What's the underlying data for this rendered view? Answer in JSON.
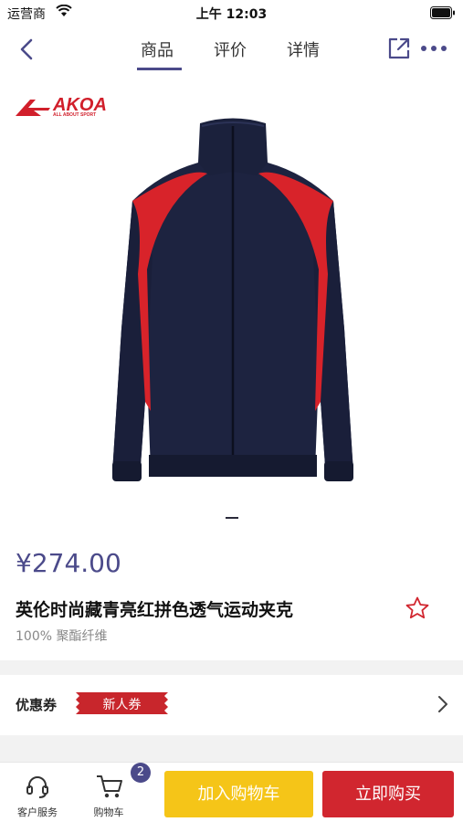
{
  "status_bar": {
    "carrier": "运营商",
    "time": "上午 12:03"
  },
  "nav": {
    "tabs": [
      {
        "label": "商品",
        "active": true
      },
      {
        "label": "评价",
        "active": false
      },
      {
        "label": "详情",
        "active": false
      }
    ],
    "icons": [
      "back-icon",
      "share-icon",
      "more-icon"
    ]
  },
  "product": {
    "brand": {
      "name": "AKOA",
      "tagline": "ALL ABOUT SPORT"
    },
    "image_indicator": {
      "current": 1,
      "total": 1
    },
    "price": "¥274.00",
    "title": "英伦时尚藏青亮红拼色透气运动夹克",
    "subtitle": "100% 聚酯纤维"
  },
  "coupon": {
    "label": "优惠券",
    "badge": "新人券"
  },
  "bottom_bar": {
    "service_label": "客户服务",
    "cart_label": "购物车",
    "cart_count": "2",
    "add_to_cart": "加入购物车",
    "buy_now": "立即购买"
  },
  "colors": {
    "accent": "#4b4a8a",
    "brand_red": "#d11f2b",
    "add_to_cart_bg": "#f5c518",
    "buy_now_bg": "#d1262f",
    "jacket_navy": "#1d2340",
    "jacket_stripe": "#d8232a"
  }
}
